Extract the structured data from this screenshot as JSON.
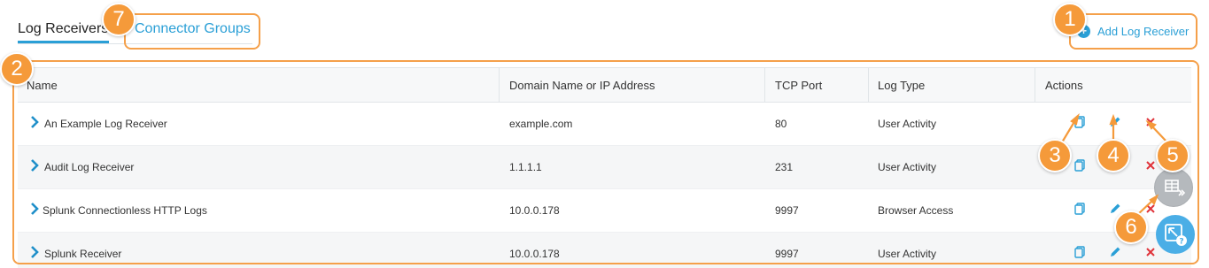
{
  "tabs": [
    {
      "label": "Log Receivers",
      "active": true
    },
    {
      "label": "Connector Groups",
      "active": false
    }
  ],
  "header": {
    "add_label": "Add Log Receiver",
    "add_icon": "plus-circle-icon"
  },
  "callouts": [
    "1",
    "2",
    "3",
    "4",
    "5",
    "6",
    "7"
  ],
  "table": {
    "columns": [
      "Name",
      "Domain Name or IP Address",
      "TCP Port",
      "Log Type",
      "Actions"
    ],
    "rows": [
      {
        "name": "An Example Log Receiver",
        "domain": "example.com",
        "port": "80",
        "log_type": "User Activity"
      },
      {
        "name": "Audit Log Receiver",
        "domain": "1.1.1.1",
        "port": "231",
        "log_type": "User Activity"
      },
      {
        "name": "Splunk Connectionless HTTP Logs",
        "domain": "10.0.0.178",
        "port": "9997",
        "log_type": "Browser Access"
      },
      {
        "name": "Splunk Receiver",
        "domain": "10.0.0.178",
        "port": "9997",
        "log_type": "User Activity"
      }
    ],
    "action_icons": [
      "copy-icon",
      "edit-icon",
      "delete-icon"
    ]
  },
  "colors": {
    "accent": "#2a9fd6",
    "callout": "#f59a3a",
    "delete": "#e0333a"
  }
}
